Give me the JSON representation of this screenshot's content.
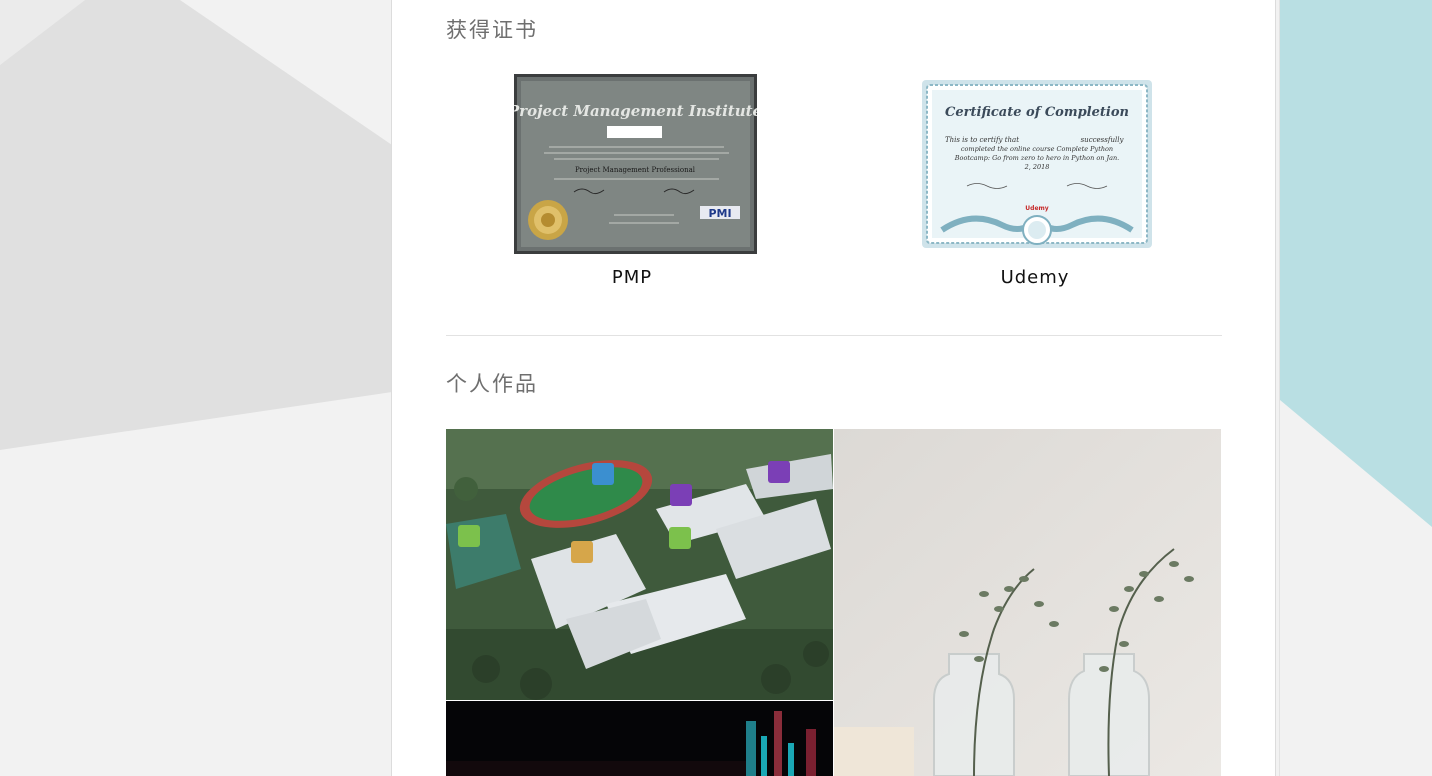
{
  "sections": {
    "certificates": {
      "title": "获得证书",
      "items": [
        {
          "caption": "PMP",
          "image": {
            "heading": "Project Management Institute",
            "subtitle": "Project Management Professional",
            "logo": "PMI"
          }
        },
        {
          "caption": "Udemy",
          "image": {
            "heading": "Certificate of Completion",
            "line1": "This is to certify that",
            "line1b": "successfully",
            "line2": "completed the online course Complete Python",
            "line3": "Bootcamp: Go from zero to hero in Python on Jan.",
            "line4": "2, 2018",
            "logo": "Udemy"
          }
        }
      ]
    },
    "works": {
      "title": "个人作品",
      "items": [
        {
          "name": "campus-aerial"
        },
        {
          "name": "glass-vases-eucalyptus"
        },
        {
          "name": "dark-abstract"
        }
      ]
    }
  },
  "colors": {
    "teal_accent": "#b9dfe3",
    "panel_bg": "#ffffff",
    "page_bg": "#f2f2f2"
  }
}
